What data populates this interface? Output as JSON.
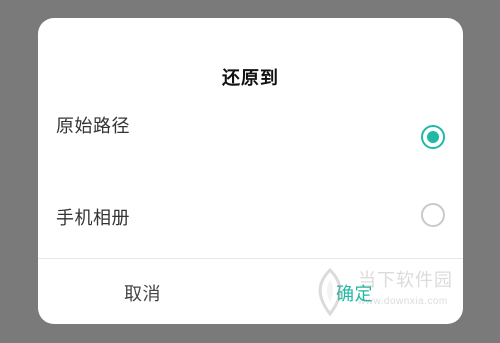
{
  "dialog": {
    "title": "还原到",
    "options": [
      {
        "label": "原始路径",
        "selected": true
      },
      {
        "label": "手机相册",
        "selected": false
      }
    ],
    "buttons": {
      "cancel": "取消",
      "confirm": "确定"
    }
  },
  "colors": {
    "accent": "#1fb9a6",
    "overlay": "#7a7a7a",
    "radio_unchecked": "#c9c9c9"
  },
  "watermark": {
    "text": "当下软件园",
    "url": "www.downxia.com"
  }
}
